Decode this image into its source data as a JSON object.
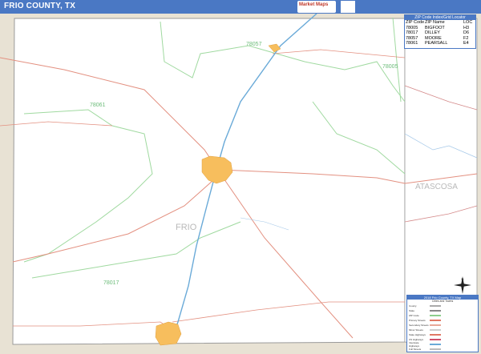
{
  "header": {
    "title": "FRIO COUNTY, TX",
    "logo_text": "Market Maps",
    "logo_badge": ""
  },
  "map": {
    "county_labels": [
      {
        "id": "frio",
        "text": "FRIO"
      },
      {
        "id": "atascosa",
        "text": "ATASCOSA"
      }
    ],
    "zip_labels": [
      {
        "id": "z78057",
        "text": "78057"
      },
      {
        "id": "z78005",
        "text": "78005"
      },
      {
        "id": "z78061",
        "text": "78061"
      },
      {
        "id": "z78017",
        "text": "78017"
      }
    ],
    "colors": {
      "title_bar": "#4a78c4",
      "county_fill": "#ffffff",
      "outside_fill": "#e6ded0",
      "roads_state": "#e07864",
      "interstate": "#6aaad8",
      "zip_boundary": "#8ccf8c",
      "city_fill": "#f7be5d"
    }
  },
  "zip_index": {
    "header": "ZIP Code Index/Grid Locator",
    "columns": [
      "ZIP Code",
      "ZIP Name",
      "LOC"
    ],
    "rows": [
      [
        "78005",
        "BIGFOOT",
        "H3"
      ],
      [
        "78017",
        "DILLEY",
        "D6"
      ],
      [
        "78057",
        "MOORE",
        "F2"
      ],
      [
        "78061",
        "PEARSALL",
        "E4"
      ]
    ]
  },
  "legend": {
    "title": "2018 Frio County, TX Map",
    "subtitle": "Cities and Towns",
    "items": [
      {
        "key": "County",
        "color": "#aaaaaa"
      },
      {
        "key": "State",
        "color": "#888888"
      },
      {
        "key": "ZIP Code",
        "color": "#8ccf8c"
      },
      {
        "key": "Primary Streets",
        "color": "#e07864"
      },
      {
        "key": "Secondary Streets",
        "color": "#e8a898"
      },
      {
        "key": "Minor Streets",
        "color": "#cccccc"
      },
      {
        "key": "State Highways",
        "color": "#e07864"
      },
      {
        "key": "US Highways",
        "color": "#d0506a"
      },
      {
        "key": "Interstate Highways",
        "color": "#6aaad8"
      },
      {
        "key": "Full Streets",
        "color": "#bbbbbb"
      }
    ]
  }
}
